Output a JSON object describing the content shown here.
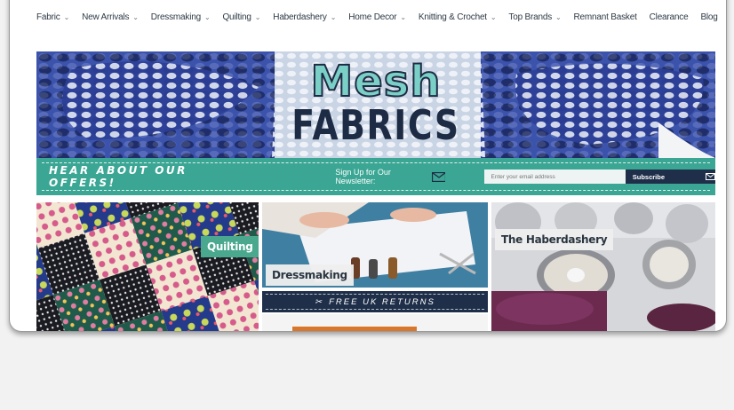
{
  "nav": {
    "items": [
      {
        "label": "Fabric",
        "has_dropdown": true
      },
      {
        "label": "New Arrivals",
        "has_dropdown": true
      },
      {
        "label": "Dressmaking",
        "has_dropdown": true
      },
      {
        "label": "Quilting",
        "has_dropdown": true
      },
      {
        "label": "Haberdashery",
        "has_dropdown": true
      },
      {
        "label": "Home Decor",
        "has_dropdown": true
      },
      {
        "label": "Knitting & Crochet",
        "has_dropdown": true
      },
      {
        "label": "Top Brands",
        "has_dropdown": true
      },
      {
        "label": "Remnant Basket",
        "has_dropdown": false
      },
      {
        "label": "Clearance",
        "has_dropdown": false
      },
      {
        "label": "Blog",
        "has_dropdown": false
      }
    ],
    "chevron_icon": "chevron-down-icon"
  },
  "hero": {
    "title_line1": "Mesh",
    "title_line2": "FABRICS",
    "mesh_color": "#3a4fa8",
    "logo_accent": "#7ad0c6"
  },
  "newsletter": {
    "headline": "HEAR ABOUT OUR OFFERS!",
    "signup_label": "Sign Up for Our Newsletter:",
    "envelope_icon": "envelope-icon",
    "email_placeholder": "Enter your email address",
    "subscribe_label": "Subscribe",
    "bar_color": "#3aa693",
    "button_color": "#1f2f4a"
  },
  "tiles": [
    {
      "label": "Quilting"
    },
    {
      "label": "Dressmaking"
    },
    {
      "label": "The Haberdashery"
    }
  ],
  "returns_banner": {
    "text": "FREE UK RETURNS",
    "icon": "scissors-icon"
  }
}
